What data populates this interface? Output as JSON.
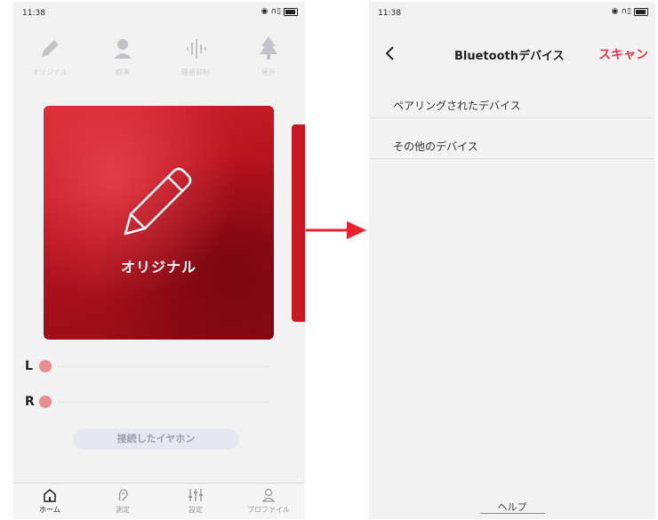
{
  "left": {
    "status": {
      "time": "11:38"
    },
    "modes": [
      {
        "label": "オリジナル",
        "icon": "pencil-icon"
      },
      {
        "label": "標準",
        "icon": "person-icon"
      },
      {
        "label": "騒音抑制",
        "icon": "waveform-icon"
      },
      {
        "label": "屋外",
        "icon": "tree-icon"
      }
    ],
    "card": {
      "title": "オリジナル"
    },
    "channels": {
      "left": "L",
      "right": "R"
    },
    "connect_button": "接続したイヤホン",
    "tabs": [
      {
        "label": "ホーム",
        "icon": "home-icon"
      },
      {
        "label": "測定",
        "icon": "ear-icon"
      },
      {
        "label": "設定",
        "icon": "sliders-icon"
      },
      {
        "label": "プロファイル",
        "icon": "profile-icon"
      }
    ]
  },
  "right": {
    "status": {
      "time": "11:38"
    },
    "nav": {
      "title": "Bluetoothデバイス",
      "action": "スキャン"
    },
    "sections": {
      "paired": "ペアリングされたデバイス",
      "other": "その他のデバイス"
    },
    "help": "ヘルプ"
  },
  "colors": {
    "accent": "#e03a48",
    "card": "#b3121e",
    "arrow": "#e8212d"
  }
}
